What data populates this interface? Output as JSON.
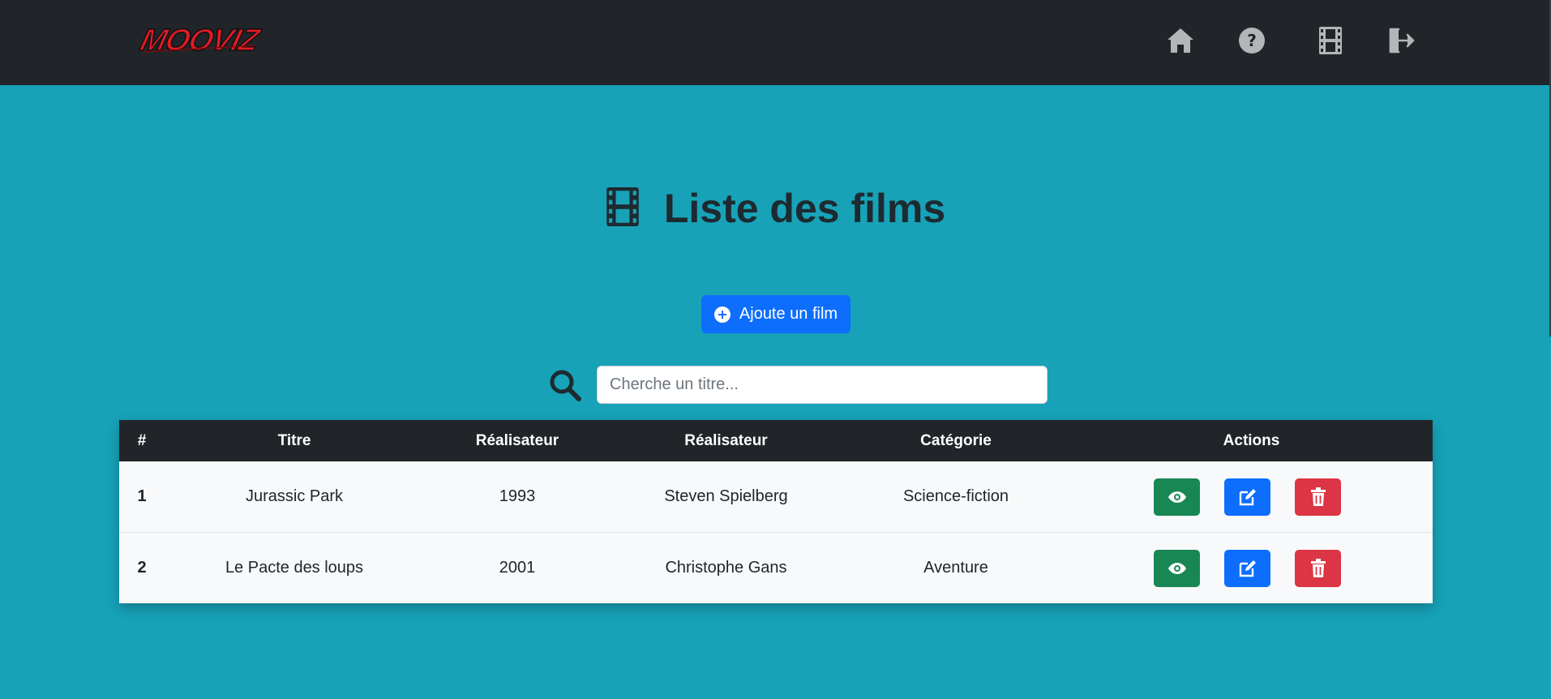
{
  "brand": {
    "logo_text": "MOOVIZ",
    "logo_color": "#e01b24"
  },
  "nav": {
    "items": [
      {
        "name": "home-icon"
      },
      {
        "name": "help-icon"
      },
      {
        "name": "film-icon"
      },
      {
        "name": "logout-icon"
      }
    ]
  },
  "page": {
    "title": "Liste des films",
    "title_icon": "film-icon"
  },
  "add_button": {
    "label": "Ajoute un film",
    "icon": "plus-circle-icon"
  },
  "search": {
    "placeholder": "Cherche un titre...",
    "value": "",
    "icon": "search-icon"
  },
  "table": {
    "headers": [
      "#",
      "Titre",
      "Réalisateur",
      "Réalisateur",
      "Catégorie",
      "Actions"
    ],
    "rows": [
      {
        "num": "1",
        "title": "Jurassic Park",
        "year": "1993",
        "director": "Steven Spielberg",
        "category": "Science-fiction"
      },
      {
        "num": "2",
        "title": "Le Pacte des loups",
        "year": "2001",
        "director": "Christophe Gans",
        "category": "Aventure"
      }
    ],
    "actions": [
      "eye-icon",
      "edit-icon",
      "trash-icon"
    ]
  },
  "colors": {
    "background": "#17a2b8",
    "navbar": "#212529",
    "primary": "#0d6efd",
    "success": "#198754",
    "danger": "#dc3545"
  }
}
